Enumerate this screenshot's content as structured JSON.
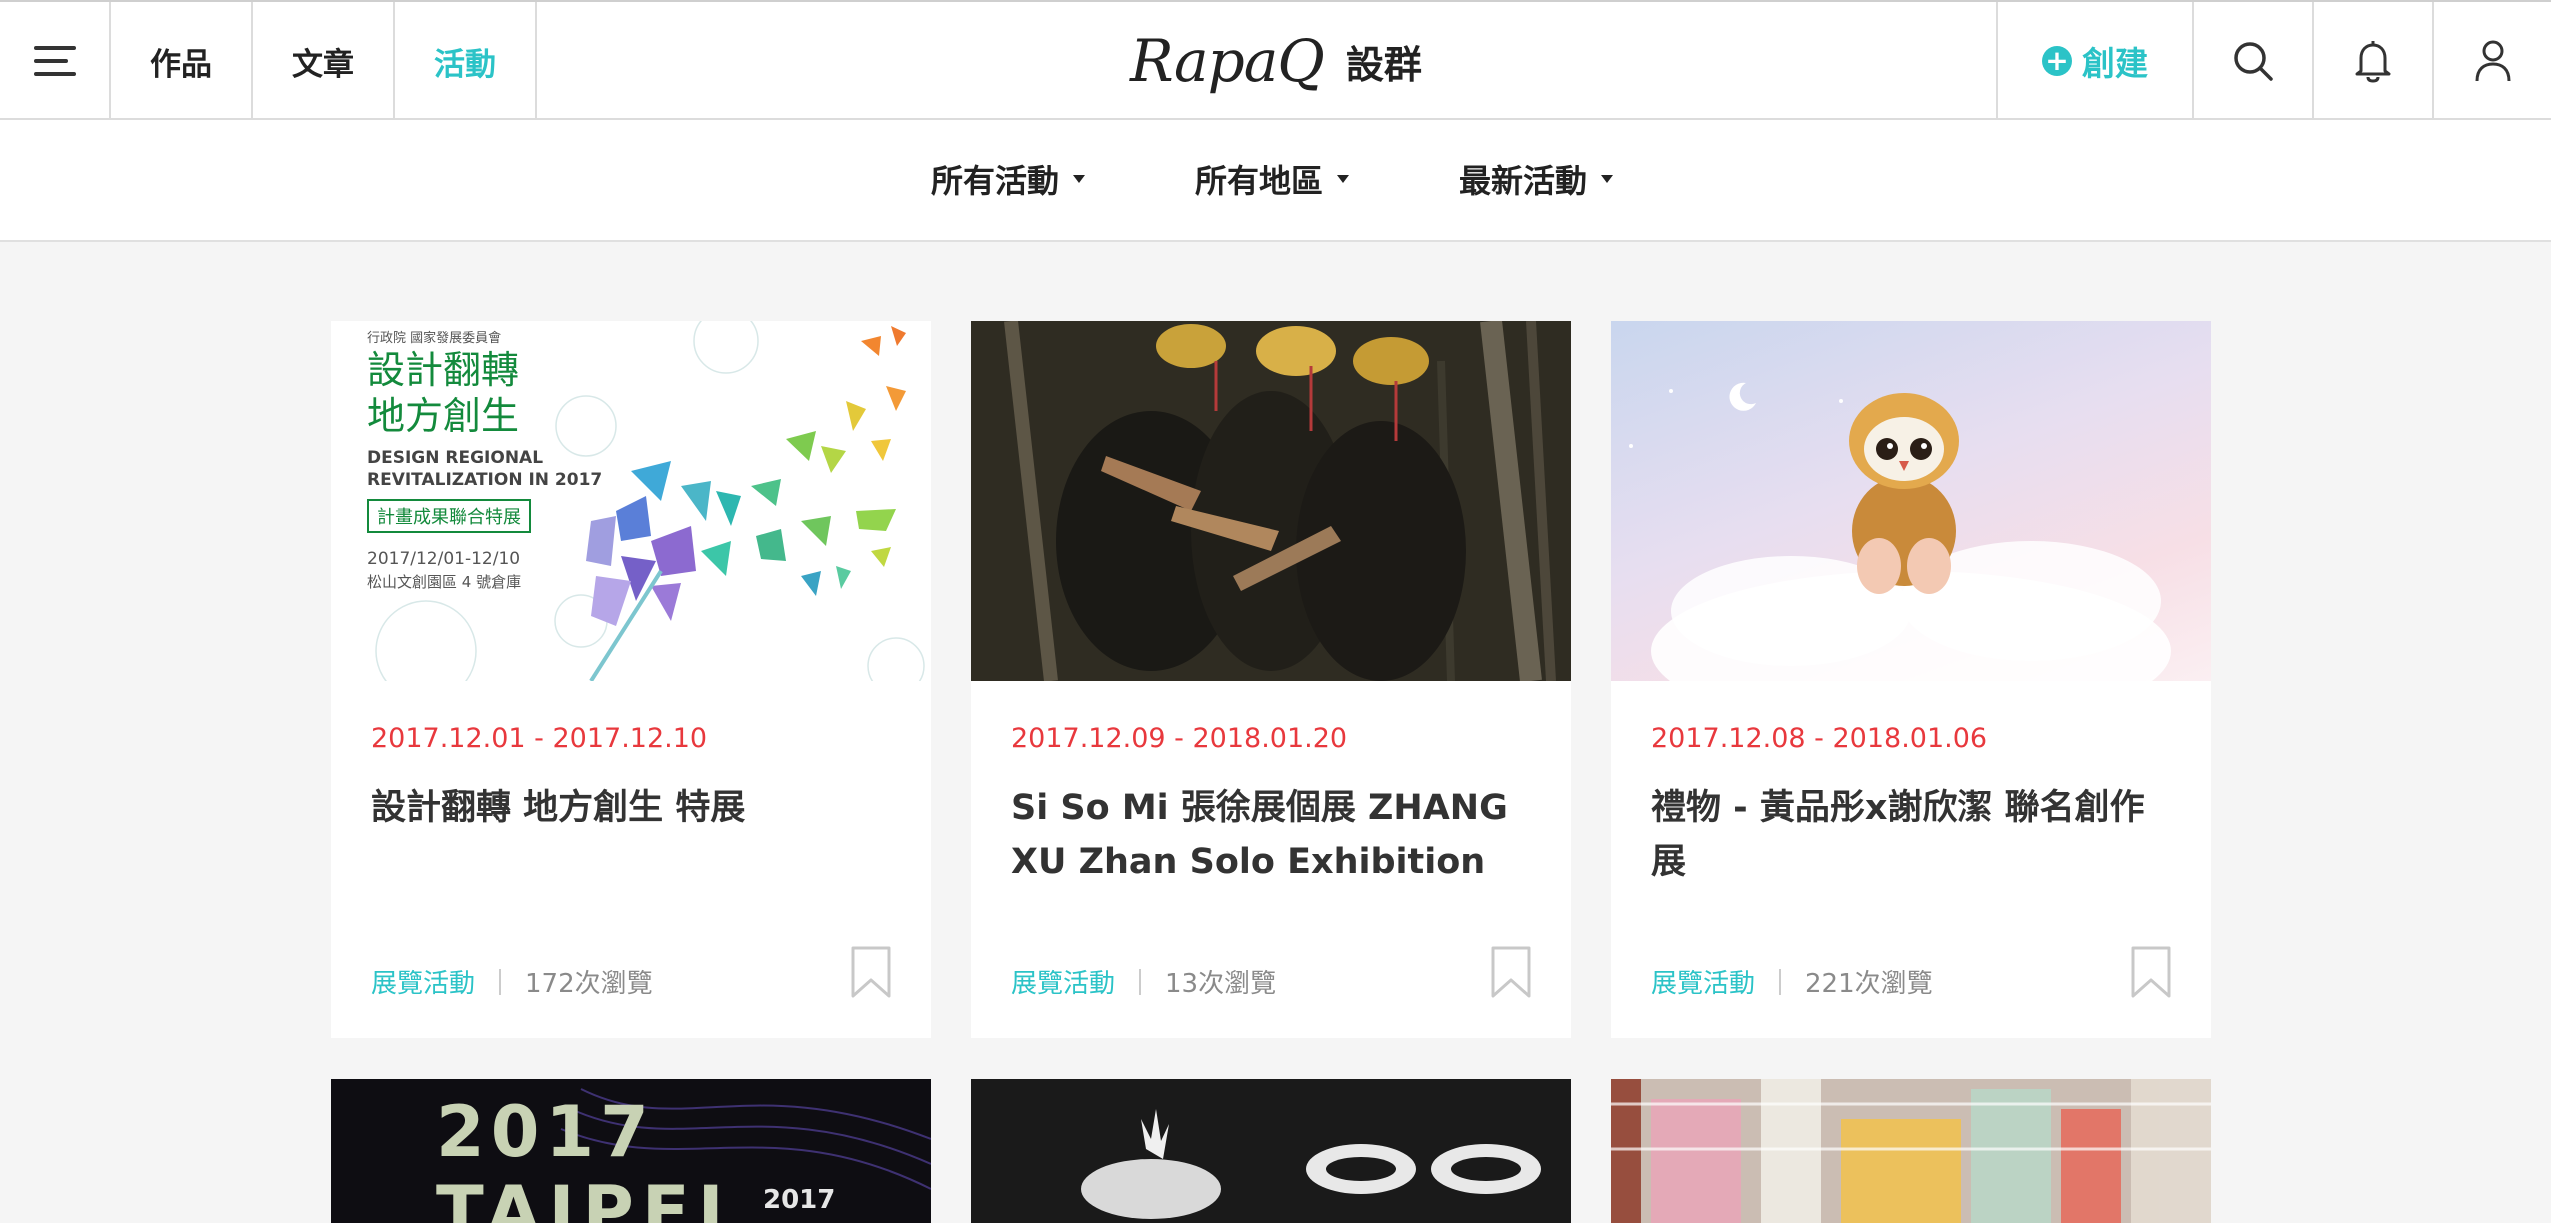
{
  "nav": {
    "items": [
      {
        "label": "作品"
      },
      {
        "label": "文章"
      },
      {
        "label": "活動"
      }
    ],
    "logo_script": "RapaQ",
    "logo_cn": "設群",
    "create_label": "創建"
  },
  "filters": [
    {
      "label": "所有活動"
    },
    {
      "label": "所有地區"
    },
    {
      "label": "最新活動"
    }
  ],
  "cards": [
    {
      "date": "2017.12.01 - 2017.12.10",
      "title": "設計翻轉 地方創生 特展",
      "category": "展覽活動",
      "views": "172次瀏覽",
      "poster": {
        "org": "行政院 國家發展委員會",
        "title_line1": "設計翻轉",
        "title_line2": "地方創生",
        "en_line1": "DESIGN REGIONAL",
        "en_line2": "REVITALIZATION IN 2017",
        "tag": "計畫成果聯合特展",
        "dates": "2017/12/01-12/10",
        "venue": "松山文創園區  4 號倉庫"
      }
    },
    {
      "date": "2017.12.09 - 2018.01.20",
      "title": "Si So Mi 張徐展個展 ZHANG XU Zhan Solo Exhibition",
      "category": "展覽活動",
      "views": "13次瀏覽"
    },
    {
      "date": "2017.12.08 - 2018.01.06",
      "title": "禮物 - 黃品彤x謝欣潔 聯名創作展",
      "category": "展覽活動",
      "views": "221次瀏覽"
    }
  ],
  "row2": {
    "poster1_year": "2017",
    "poster1_city": "TAIPEI",
    "poster1_small": "2017"
  },
  "colors": {
    "accent": "#2bc3c7",
    "date": "#e8383d"
  }
}
